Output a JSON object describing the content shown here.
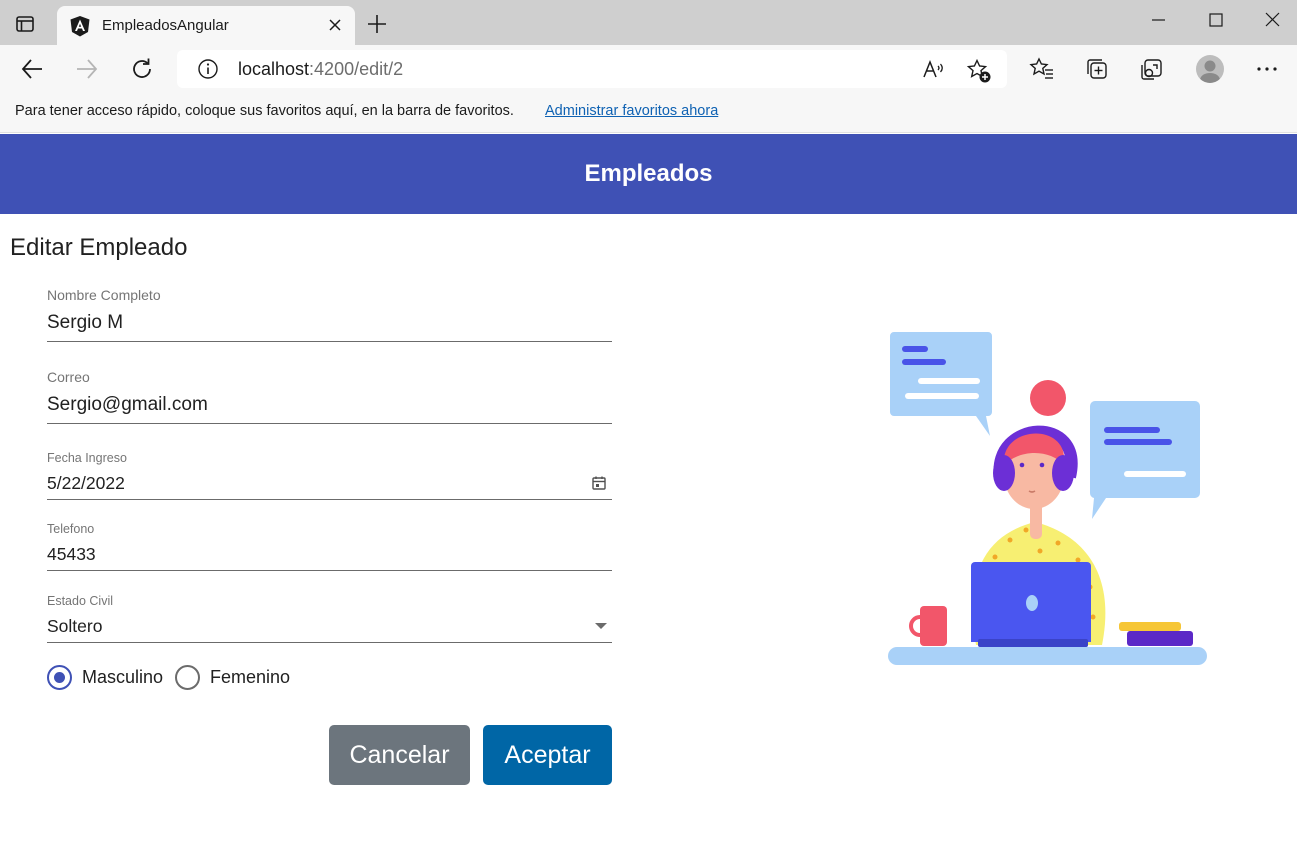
{
  "browser": {
    "tab_title": "EmpleadosAngular",
    "url_host": "localhost",
    "url_rest": ":4200/edit/2",
    "favorites_bar_text": "Para tener acceso rápido, coloque sus favoritos aquí, en la barra de favoritos.",
    "favorites_bar_link": "Administrar favoritos ahora"
  },
  "header": {
    "title": "Empleados"
  },
  "form": {
    "heading": "Editar Empleado",
    "name_label": "Nombre Completo",
    "name_value": "Sergio M",
    "email_label": "Correo",
    "email_value": "Sergio@gmail.com",
    "date_label": "Fecha Ingreso",
    "date_value": "5/22/2022",
    "phone_label": "Telefono",
    "phone_value": "45433",
    "status_label": "Estado Civil",
    "status_value": "Soltero",
    "gender_male": "Masculino",
    "gender_female": "Femenino",
    "gender_selected": "Masculino",
    "cancel_label": "Cancelar",
    "accept_label": "Aceptar"
  },
  "colors": {
    "header": "#3f51b5",
    "accept_button": "#0066a6",
    "cancel_button": "#6c757d",
    "link": "#0f62b3"
  },
  "icons": [
    "tab-actions-icon",
    "angular-logo-icon",
    "close-icon",
    "plus-icon",
    "minimize-icon",
    "maximize-icon",
    "window-close-icon",
    "back-arrow-icon",
    "forward-arrow-icon",
    "refresh-icon",
    "info-icon",
    "read-aloud-icon",
    "add-favorite-icon",
    "favorites-icon",
    "collections-icon",
    "browser-essentials-icon",
    "profile-avatar",
    "more-icon",
    "calendar-icon",
    "dropdown-arrow-icon"
  ]
}
